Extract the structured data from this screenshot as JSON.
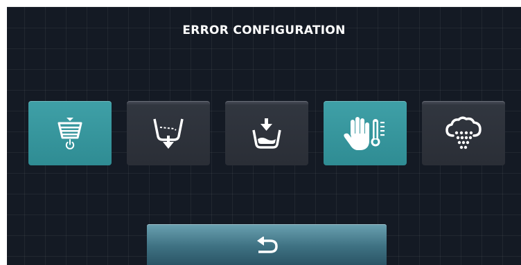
{
  "screen": {
    "title": "ERROR CONFIGURATION"
  },
  "tiles": [
    {
      "icon": "tank-power-icon",
      "state": "active"
    },
    {
      "icon": "drain-icon",
      "state": "inactive"
    },
    {
      "icon": "fill-water-icon",
      "state": "inactive"
    },
    {
      "icon": "hand-temperature-icon",
      "state": "active"
    },
    {
      "icon": "steam-cloud-icon",
      "state": "inactive"
    }
  ],
  "footer": {
    "back_icon": "back-arrow-icon"
  },
  "colors": {
    "background": "#141a24",
    "tile_active": "#3499a0",
    "tile_inactive": "#2e323a",
    "back_button": "#4f8797",
    "icon": "#ffffff"
  }
}
